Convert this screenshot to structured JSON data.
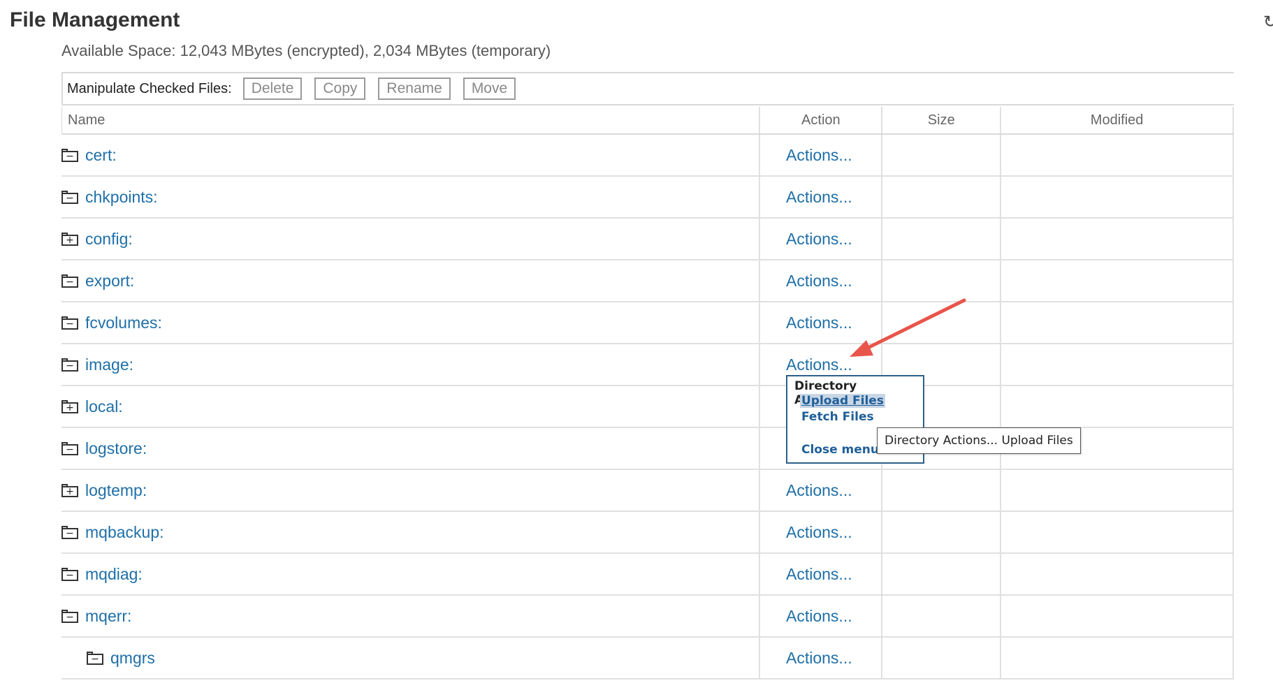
{
  "header": {
    "title": "File Management",
    "available_space": "Available Space: 12,043 MBytes (encrypted), 2,034 MBytes (temporary)"
  },
  "toolbar": {
    "label": "Manipulate Checked Files:",
    "buttons": [
      "Delete",
      "Copy",
      "Rename",
      "Move"
    ]
  },
  "table": {
    "columns": [
      "Name",
      "Action",
      "Size",
      "Modified"
    ],
    "rows": [
      {
        "name": "cert:",
        "icon": "minus",
        "action": "Actions..."
      },
      {
        "name": "chkpoints:",
        "icon": "minus",
        "action": "Actions..."
      },
      {
        "name": "config:",
        "icon": "plus",
        "action": "Actions..."
      },
      {
        "name": "export:",
        "icon": "minus",
        "action": "Actions..."
      },
      {
        "name": "fcvolumes:",
        "icon": "minus",
        "action": "Actions..."
      },
      {
        "name": "image:",
        "icon": "minus",
        "action": "Actions..."
      },
      {
        "name": "local:",
        "icon": "plus",
        "action": ""
      },
      {
        "name": "logstore:",
        "icon": "minus",
        "action": ""
      },
      {
        "name": "logtemp:",
        "icon": "plus",
        "action": "Actions..."
      },
      {
        "name": "mqbackup:",
        "icon": "minus",
        "action": "Actions..."
      },
      {
        "name": "mqdiag:",
        "icon": "minus",
        "action": "Actions..."
      },
      {
        "name": "mqerr:",
        "icon": "minus",
        "action": "Actions..."
      },
      {
        "name": "qmgrs",
        "icon": "minus",
        "action": "Actions..."
      }
    ]
  },
  "popup": {
    "title": "Directory Actions...",
    "items": [
      "Upload Files",
      "Fetch Files",
      "Close menu"
    ]
  },
  "tooltip": {
    "text": "Directory Actions... Upload Files"
  },
  "colors": {
    "link": "#1f6fa8",
    "annotation_arrow": "#e8554a",
    "highlight": "#c8d6e5"
  }
}
